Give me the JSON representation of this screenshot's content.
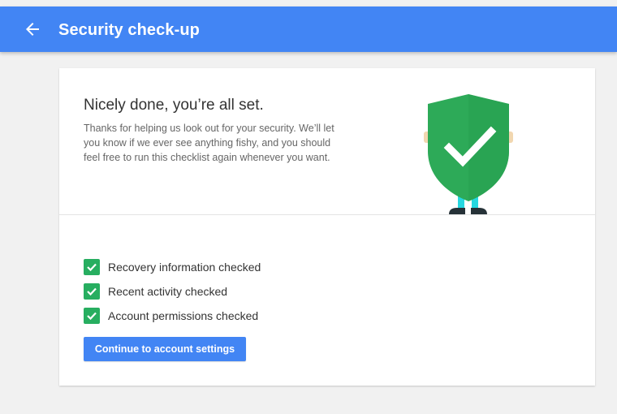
{
  "appbar": {
    "title": "Security check-up",
    "back_icon": "arrow-back-icon",
    "color": "#4285f4"
  },
  "summary": {
    "headline": "Nicely done, you’re all set.",
    "message": "Thanks for helping us look out for your security. We’ll let you know if we ever see anything fishy, and you should feel free to run this checklist again whenever you want.",
    "illustration": "shield-checkmark-icon"
  },
  "checklist": {
    "items": [
      {
        "label": "Recovery information checked",
        "checked": true
      },
      {
        "label": "Recent activity checked",
        "checked": true
      },
      {
        "label": "Account permissions checked",
        "checked": true
      }
    ],
    "check_color": "#27ae60"
  },
  "actions": {
    "continue_label": "Continue to account settings"
  }
}
